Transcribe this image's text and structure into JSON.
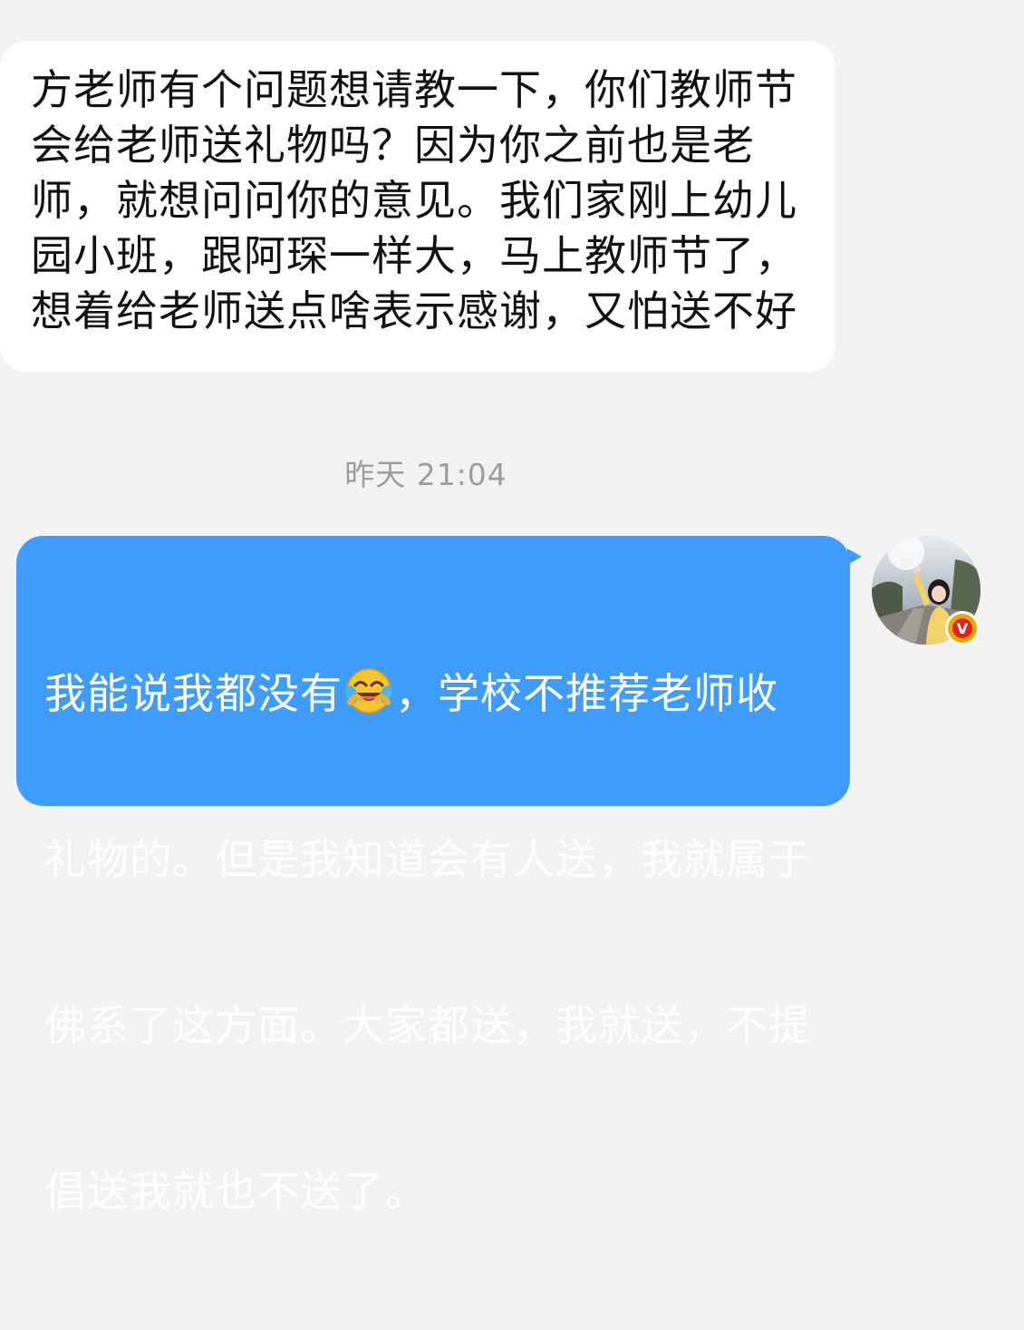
{
  "conversation": {
    "incoming_message": {
      "lines": [
        "方老师有个问题想请教一下，你们教师节",
        "会给老师送礼物吗？因为你之前也是老",
        "师，就想问问你的意见。我们家刚上幼儿",
        "园小班，跟阿琛一样大，马上教师节了，",
        "想着给老师送点啥表示感谢，又怕送不好"
      ]
    },
    "timestamp": "昨天 21:04",
    "outgoing_message": {
      "line1_before_emoji": "我能说我都没有",
      "emoji": "crying-laughing-emoji",
      "line1_after_emoji": "，学校不推荐老师收",
      "lines": [
        "礼物的。但是我知道会有人送，我就属于",
        "佛系了这方面。大家都送，我就送，不提",
        "倡送我就也不送了。"
      ]
    },
    "sender_avatar": {
      "icon": "user-avatar",
      "badge": "V"
    }
  },
  "colors": {
    "background": "#f2f2f2",
    "incoming_bubble": "#ffffff",
    "outgoing_bubble": "#3f9cfa",
    "timestamp_text": "#9d9d9d",
    "badge": "#f0a500"
  }
}
